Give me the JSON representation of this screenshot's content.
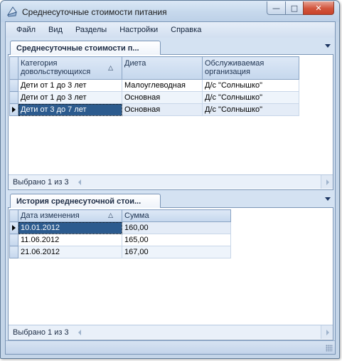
{
  "window": {
    "title": "Среднесуточные стоимости питания",
    "controls": {
      "minimize": "—",
      "maximize": "□",
      "close": "✕"
    }
  },
  "menu": [
    "Файл",
    "Вид",
    "Разделы",
    "Настройки",
    "Справка"
  ],
  "panel_top": {
    "tab_label": "Среднесуточные стоимости п...",
    "columns": [
      "Категория довольствующихся",
      "Диета",
      "Обслуживаемая организация"
    ],
    "sort_glyph": "△",
    "rows": [
      {
        "category": "Дети от 1 до 3 лет",
        "diet": "Малоуглеводная",
        "org": "Д/с \"Солнышко\""
      },
      {
        "category": "Дети от 1 до 3 лет",
        "diet": "Основная",
        "org": "Д/с \"Солнышко\""
      },
      {
        "category": "Дети от 3 до 7 лет",
        "diet": "Основная",
        "org": "Д/с \"Солнышко\""
      }
    ],
    "selected_row": 2,
    "status": "Выбрано 1 из 3"
  },
  "panel_bottom": {
    "tab_label": "История среднесуточной стои...",
    "columns": [
      "Дата изменения",
      "Сумма"
    ],
    "sort_glyph": "△",
    "rows": [
      {
        "date": "10.01.2012",
        "sum": "160,00"
      },
      {
        "date": "11.06.2012",
        "sum": "165,00"
      },
      {
        "date": "21.06.2012",
        "sum": "167,00"
      }
    ],
    "selected_row": 0,
    "status": "Выбрано 1 из 3"
  },
  "icons": {
    "app": "app-icon",
    "sort": "sort-ascending-icon",
    "row_pointer": "row-pointer-icon",
    "panel_menu": "chevron-down-icon",
    "size_grip": "size-grip-icon"
  }
}
